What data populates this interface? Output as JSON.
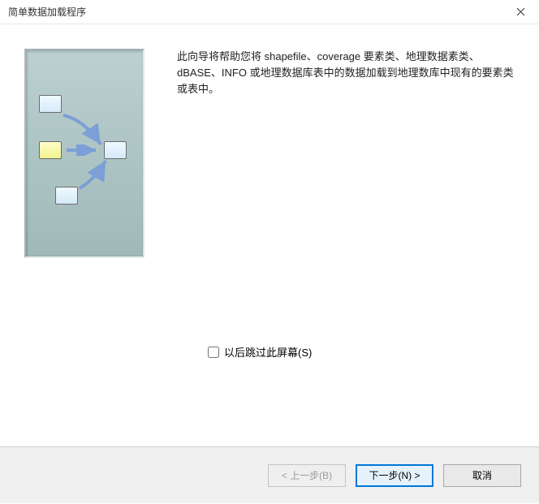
{
  "title": "简单数据加载程序",
  "description": "此向导将帮助您将 shapefile、coverage 要素类、地理数据素类、dBASE、INFO 或地理数据库表中的数据加载到地理数库中现有的要素类或表中。",
  "skip_label": "以后跳过此屏幕(S)",
  "buttons": {
    "back": "< 上一步(B)",
    "next": "下一步(N) >",
    "cancel": "取消"
  }
}
